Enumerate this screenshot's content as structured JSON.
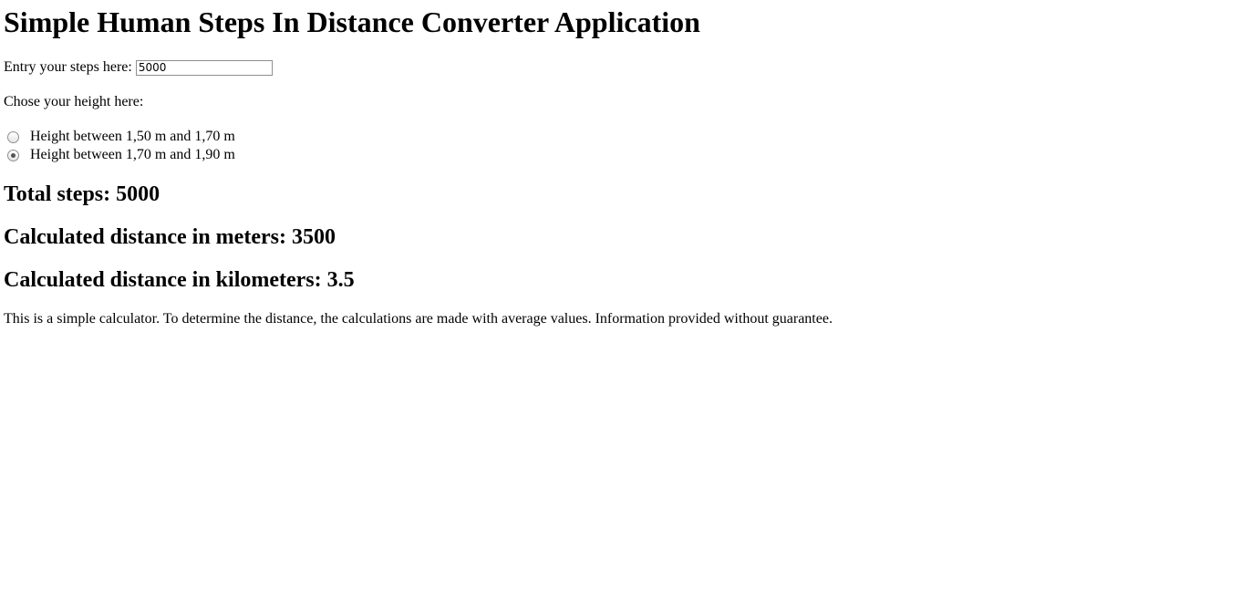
{
  "page": {
    "title": "Simple Human Steps In Distance Converter Application"
  },
  "steps": {
    "label": "Entry your steps here:",
    "value": "5000"
  },
  "height": {
    "label": "Chose your height here:",
    "options": [
      {
        "label": "Height between 1,50 m and 1,70 m",
        "checked": false
      },
      {
        "label": "Height between 1,70 m and 1,90 m",
        "checked": true
      }
    ]
  },
  "results": {
    "total_steps_label": "Total steps:",
    "total_steps": "5000",
    "meters_label": "Calculated distance in meters:",
    "meters": "3500",
    "km_label": "Calculated distance in kilometers:",
    "km": "3.5"
  },
  "footer": {
    "note": "This is a simple calculator. To determine the distance, the calculations are made with average values. Information provided without guarantee."
  }
}
